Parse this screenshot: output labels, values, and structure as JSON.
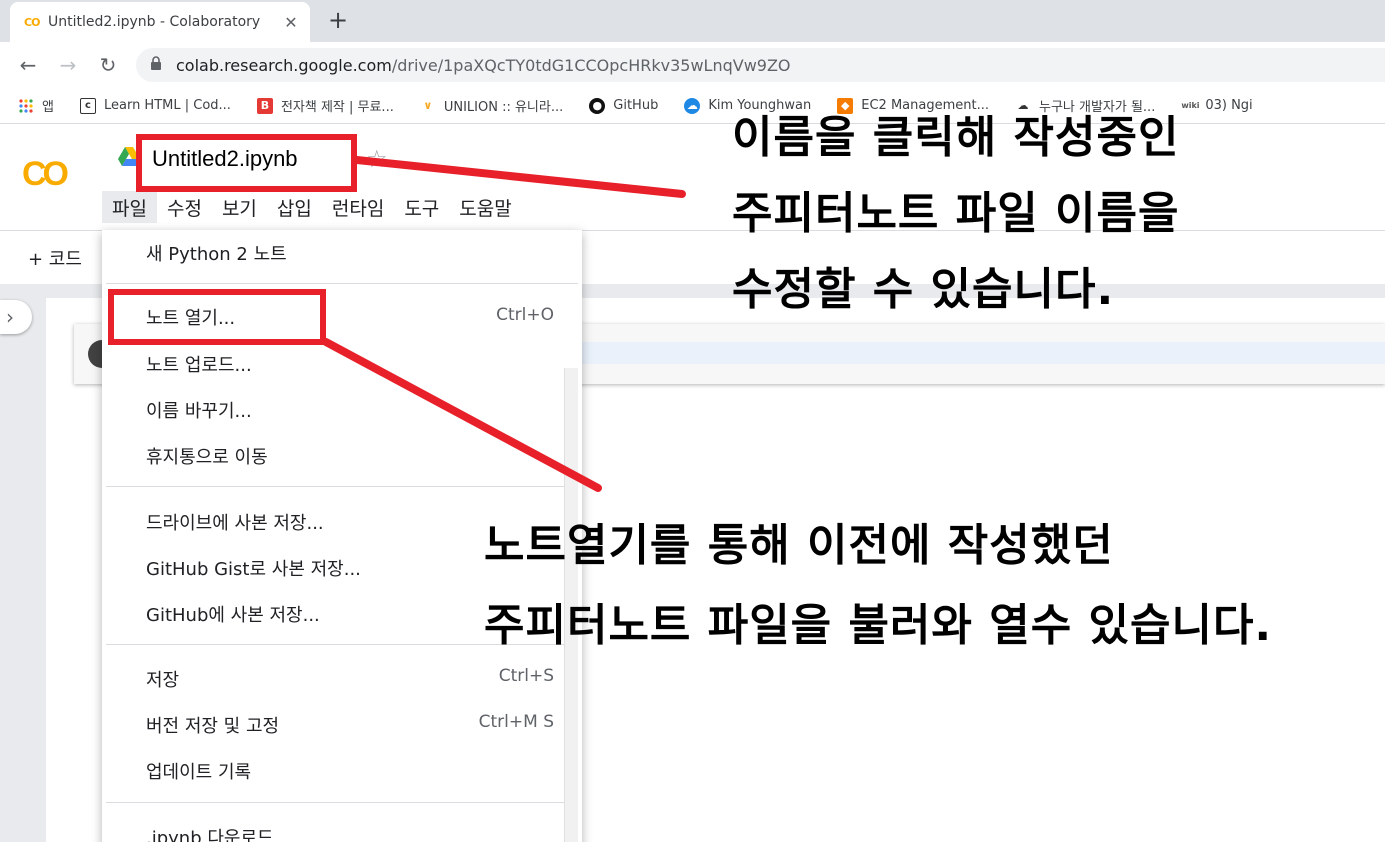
{
  "browser": {
    "tab_title": "Untitled2.ipynb - Colaboratory",
    "tab_favicon": "CO",
    "tab_close": "✕",
    "new_tab": "+",
    "url_host": "colab.research.google.com",
    "url_path": "/drive/1paXQcTY0tdG1CCOpcHRkv35wLnqVw9ZO"
  },
  "bookmarks": [
    {
      "label": "앱",
      "icon": "apps-grid-icon"
    },
    {
      "label": "Learn HTML | Cod...",
      "icon": "codecademy-icon"
    },
    {
      "label": "전자책 제작 | 무료...",
      "icon": "ebook-icon"
    },
    {
      "label": "UNILION :: 유니라...",
      "icon": "unilion-icon"
    },
    {
      "label": "GitHub",
      "icon": "github-icon"
    },
    {
      "label": "Kim Younghwan",
      "icon": "cloud-icon"
    },
    {
      "label": "EC2 Management...",
      "icon": "aws-icon"
    },
    {
      "label": "누구나 개발자가 될...",
      "icon": "cloud-outline-icon"
    },
    {
      "label": "03) Ngi",
      "icon": "wikidocs-icon"
    }
  ],
  "colab": {
    "logo": "CO",
    "doc_title": "Untitled2.ipynb",
    "menus": [
      "파일",
      "수정",
      "보기",
      "삽입",
      "런타임",
      "도구",
      "도움말"
    ],
    "toolbar_code": "+ 코드"
  },
  "file_menu": [
    {
      "label": "새 Python 2 노트",
      "shortcut": ""
    },
    {
      "label": "노트 열기...",
      "shortcut": "Ctrl+O"
    },
    {
      "label": "노트 업로드...",
      "shortcut": ""
    },
    {
      "label": "이름 바꾸기...",
      "shortcut": ""
    },
    {
      "label": "휴지통으로 이동",
      "shortcut": ""
    },
    {
      "label": "드라이브에 사본 저장...",
      "shortcut": ""
    },
    {
      "label": "GitHub Gist로 사본 저장...",
      "shortcut": ""
    },
    {
      "label": "GitHub에 사본 저장...",
      "shortcut": ""
    },
    {
      "label": "저장",
      "shortcut": "Ctrl+S"
    },
    {
      "label": "버전 저장 및 고정",
      "shortcut": "Ctrl+M S"
    },
    {
      "label": "업데이트 기록",
      "shortcut": ""
    },
    {
      "label": ".ipynb 다운로드",
      "shortcut": ""
    }
  ],
  "annotations": {
    "rename_lines": [
      "이름을 클릭해 작성중인",
      "주피터노트 파일 이름을",
      "수정할 수 있습니다."
    ],
    "open_lines": [
      "노트열기를 통해 이전에 작성했던",
      "주피터노트 파일을 불러와 열수 있습니다."
    ],
    "highlight_color": "#e8202a"
  }
}
